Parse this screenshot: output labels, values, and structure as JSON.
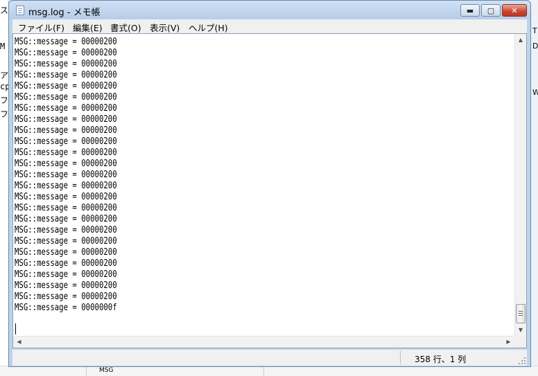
{
  "background": {
    "left_fragments": [
      "ス",
      "M",
      "ア",
      "cp",
      "フ",
      "フ"
    ],
    "right_fragments": [
      "T",
      "D",
      "W"
    ],
    "bottom_label": "MSG"
  },
  "window": {
    "title": "msg.log - メモ帳",
    "controls": {
      "minimize": "▬",
      "maximize": "▢",
      "close": "✕"
    }
  },
  "menu": {
    "items": [
      "ファイル(F)",
      "編集(E)",
      "書式(O)",
      "表示(V)",
      "ヘルプ(H)"
    ]
  },
  "editor": {
    "lines": [
      "MSG::message = 00000200",
      "MSG::message = 00000200",
      "MSG::message = 00000200",
      "MSG::message = 00000200",
      "MSG::message = 00000200",
      "MSG::message = 00000200",
      "MSG::message = 00000200",
      "MSG::message = 00000200",
      "MSG::message = 00000200",
      "MSG::message = 00000200",
      "MSG::message = 00000200",
      "MSG::message = 00000200",
      "MSG::message = 00000200",
      "MSG::message = 00000200",
      "MSG::message = 00000200",
      "MSG::message = 00000200",
      "MSG::message = 00000200",
      "MSG::message = 00000200",
      "MSG::message = 00000200",
      "MSG::message = 00000200",
      "MSG::message = 00000200",
      "MSG::message = 00000200",
      "MSG::message = 00000200",
      "MSG::message = 00000200",
      "MSG::message = 0000000f"
    ]
  },
  "scrollbar": {
    "up": "▲",
    "down": "▼",
    "left": "◀",
    "right": "▶"
  },
  "status": {
    "position": "358 行、1 列"
  }
}
